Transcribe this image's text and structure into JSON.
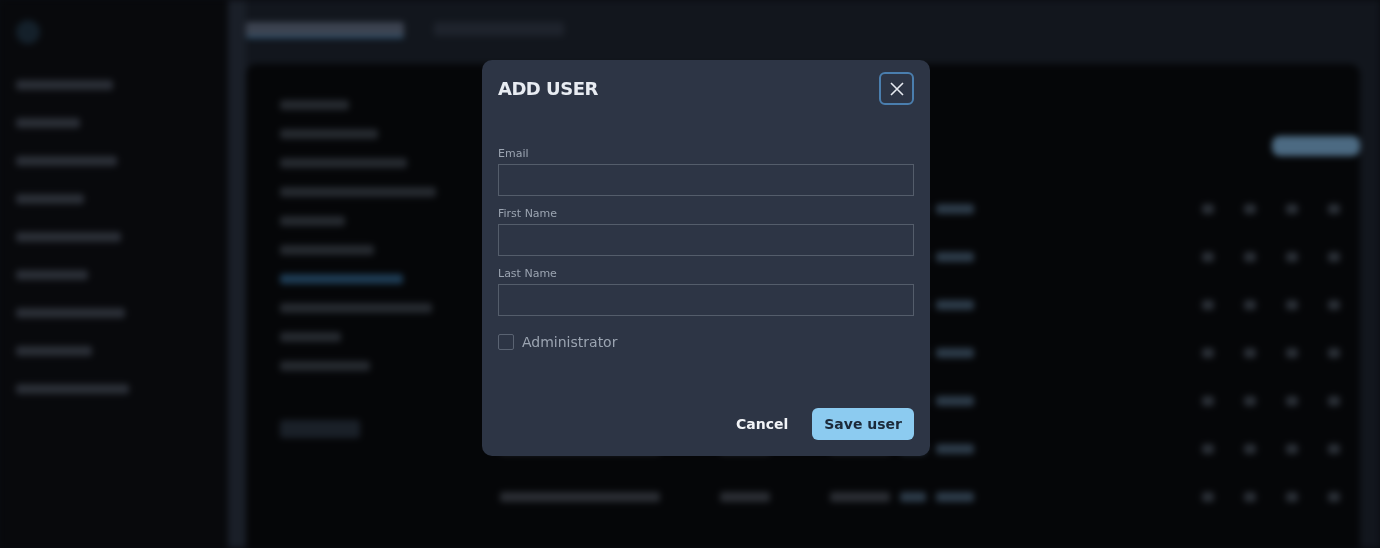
{
  "dialog": {
    "title": "ADD USER",
    "fields": [
      {
        "label": "Email"
      },
      {
        "label": "First Name"
      },
      {
        "label": "Last Name"
      }
    ],
    "checkbox": {
      "label": "Administrator",
      "checked": false
    },
    "buttons": [
      {
        "label": "Cancel",
        "kind": "text"
      },
      {
        "label": "Save user",
        "kind": "primary"
      }
    ]
  }
}
